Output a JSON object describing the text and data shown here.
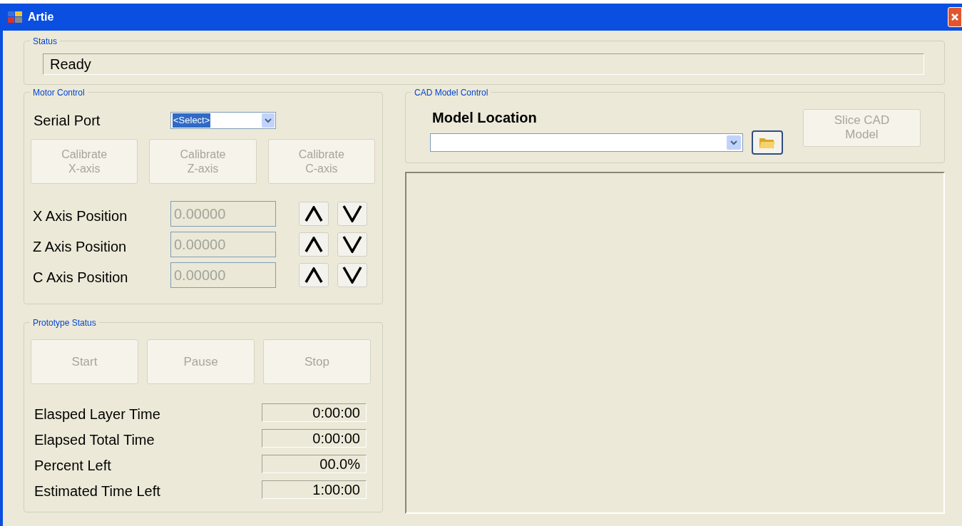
{
  "window": {
    "title": "Artie"
  },
  "status": {
    "group_label": "Status",
    "text": "Ready"
  },
  "motor_control": {
    "group_label": "Motor Control",
    "serial_port": {
      "label": "Serial Port",
      "value": "<Select>",
      "text_selected": true
    },
    "calibrate_buttons": [
      {
        "lines": [
          "Calibrate",
          "X-axis"
        ],
        "disabled": true
      },
      {
        "lines": [
          "Calibrate",
          "Z-axis"
        ],
        "disabled": true
      },
      {
        "lines": [
          "Calibrate",
          "C-axis"
        ],
        "disabled": true
      }
    ],
    "axes": [
      {
        "label": "X Axis Position",
        "value": "0.00000",
        "disabled": true
      },
      {
        "label": "Z Axis Position",
        "value": "0.00000",
        "disabled": true
      },
      {
        "label": "C Axis Position",
        "value": "0.00000",
        "disabled": true
      }
    ]
  },
  "prototype_status": {
    "group_label": "Prototype Status",
    "buttons": [
      {
        "label": "Start",
        "disabled": true
      },
      {
        "label": "Pause",
        "disabled": true
      },
      {
        "label": "Stop",
        "disabled": true
      }
    ],
    "readouts": [
      {
        "label": "Elasped Layer Time",
        "value": "0:00:00"
      },
      {
        "label": "Elapsed Total Time",
        "value": "0:00:00"
      },
      {
        "label": "Percent Left",
        "value": "00.0%"
      },
      {
        "label": "Estimated Time Left",
        "value": "1:00:00"
      }
    ]
  },
  "cad_model_control": {
    "group_label": "CAD Model Control",
    "model_location_label": "Model Location",
    "slice_button": {
      "lines": [
        "Slice CAD",
        "Model"
      ],
      "disabled": true
    }
  }
}
